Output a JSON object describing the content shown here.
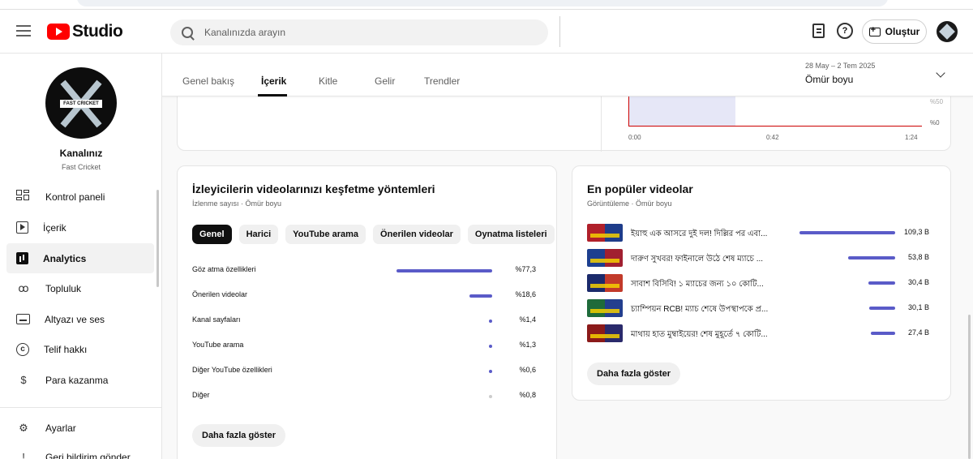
{
  "header": {
    "logo_text": "Studio",
    "search_placeholder": "Kanalınızda arayın",
    "help_label": "?",
    "create_label": "Oluştur"
  },
  "sidebar": {
    "channel_label": "Kanalınız",
    "channel_name": "Fast Cricket",
    "avatar_banner": "FAST CRICKET",
    "items": [
      {
        "label": "Kontrol paneli",
        "icon": "dashboard-icon"
      },
      {
        "label": "İçerik",
        "icon": "content-icon"
      },
      {
        "label": "Analytics",
        "icon": "analytics-icon",
        "active": true
      },
      {
        "label": "Topluluk",
        "icon": "community-icon"
      },
      {
        "label": "Altyazı ve ses",
        "icon": "subtitles-icon"
      },
      {
        "label": "Telif hakkı",
        "icon": "copyright-icon"
      },
      {
        "label": "Para kazanma",
        "icon": "monetization-icon"
      }
    ],
    "bottom_items": [
      {
        "label": "Ayarlar",
        "icon": "settings-icon"
      },
      {
        "label": "Geri bildirim gönder",
        "icon": "feedback-icon"
      }
    ]
  },
  "tabs": {
    "items": [
      "Genel bakış",
      "İçerik",
      "Kitle",
      "Gelir",
      "Trendler"
    ],
    "active_index": 1
  },
  "date_filter": {
    "range": "28 May – 2 Tem 2025",
    "period": "Ömür boyu"
  },
  "retention": {
    "ticks": [
      "0:00",
      "0:42",
      "1:24"
    ],
    "pct_top": "%50",
    "pct_bottom": "%0"
  },
  "discovery": {
    "title": "İzleyicilerin videolarınızı keşfetme yöntemleri",
    "subtitle": "İzlenme sayısı · Ömür boyu",
    "chips": [
      "Genel",
      "Harici",
      "YouTube arama",
      "Önerilen videolar",
      "Oynatma listeleri"
    ],
    "selected_chip": 0,
    "rows": [
      {
        "label": "Göz atma özellikleri",
        "value": "%77,3",
        "share": 77.3
      },
      {
        "label": "Önerilen videolar",
        "value": "%18,6",
        "share": 18.6
      },
      {
        "label": "Kanal sayfaları",
        "value": "%1,4",
        "share": 1.4
      },
      {
        "label": "YouTube arama",
        "value": "%1,3",
        "share": 1.3
      },
      {
        "label": "Diğer YouTube özellikleri",
        "value": "%0,6",
        "share": 0.6
      },
      {
        "label": "Diğer",
        "value": "%0,8",
        "share": 0.8
      }
    ],
    "more_label": "Daha fazla göster"
  },
  "popular": {
    "title": "En popüler videolar",
    "subtitle": "Görüntüleme · Ömür boyu",
    "videos": [
      {
        "title": "ইয়াহু এক আসরে দুই দল! দিল্লির পর এবা...",
        "value": "109,3 B",
        "views": 109.3
      },
      {
        "title": "দারুণ সুখবর! ফাইনালে উঠে শেষ ম্যাচে ...",
        "value": "53,8 B",
        "views": 53.8
      },
      {
        "title": "সাবাশ বিসিবি! ১ ম্যাচের জন্য ১০ কোটি...",
        "value": "30,4 B",
        "views": 30.4
      },
      {
        "title": "চ্যাম্পিয়ন RCB! ম্যাচ শেষে উপস্থাপকে প্র...",
        "value": "30,1 B",
        "views": 30.1
      },
      {
        "title": "মাথায় হাত মুম্বাইয়ের! শেষ মুহূর্তে ৭ কোটি...",
        "value": "27,4 B",
        "views": 27.4
      }
    ],
    "more_label": "Daha fazla göster"
  },
  "colors": {
    "accent_bar": "#5a5bc8",
    "other_dot": "#cccccc",
    "brand_red": "#ff0000"
  }
}
